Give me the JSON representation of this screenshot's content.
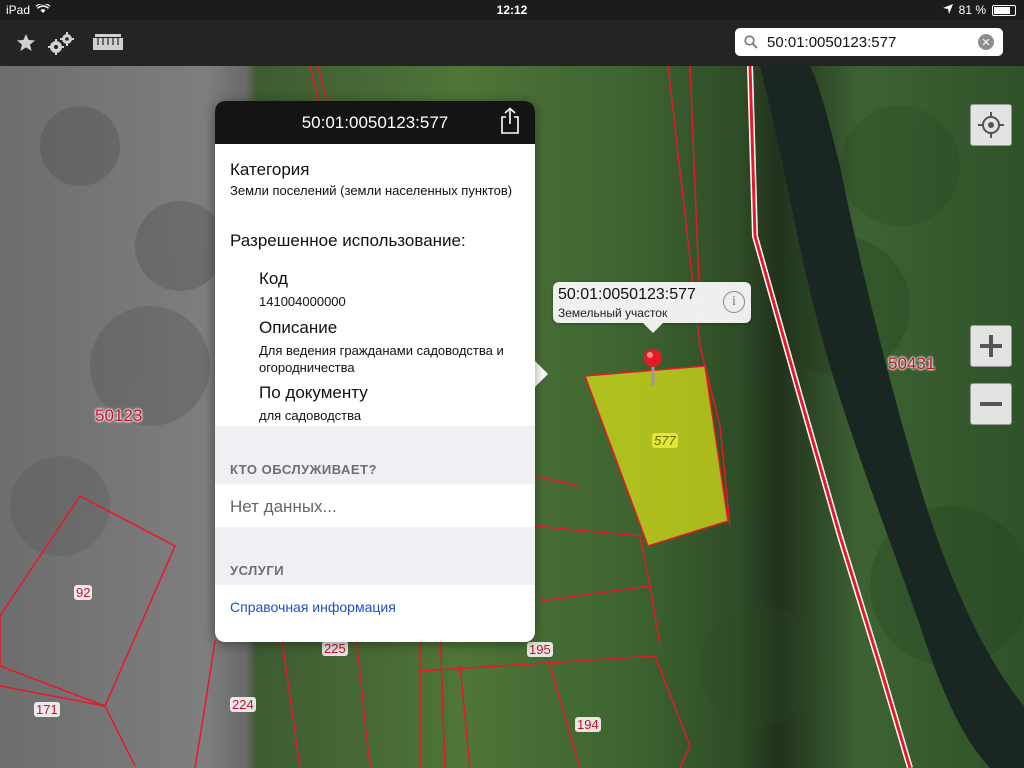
{
  "status_bar": {
    "device": "iPad",
    "time": "12:12",
    "battery": "81 %",
    "battery_level": 0.81
  },
  "toolbar": {
    "search": {
      "value": "50:01:0050123:577",
      "placeholder": ""
    }
  },
  "map": {
    "labels": [
      "50123",
      "50431"
    ],
    "parcels": [
      "92",
      "171",
      "224",
      "225",
      "195",
      "194"
    ],
    "selected_parcel_label": "577"
  },
  "callout": {
    "title": "50:01:0050123:577",
    "subtitle": "Земельный участок"
  },
  "popover": {
    "title": "50:01:0050123:577",
    "category_heading": "Категория",
    "category_value": "Земли поселений (земли населенных пунктов)",
    "permitted_use_heading": "Разрешенное использование:",
    "code_heading": "Код",
    "code_value": "141004000000",
    "description_heading": "Описание",
    "description_value": "Для ведения гражданами садоводства и огородничества",
    "by_document_heading": "По документу",
    "by_document_value": "для садоводства",
    "servicer_section": "КТО ОБСЛУЖИВАЕТ?",
    "servicer_value": "Нет данных...",
    "services_section": "УСЛУГИ",
    "services_link": "Справочная информация"
  }
}
